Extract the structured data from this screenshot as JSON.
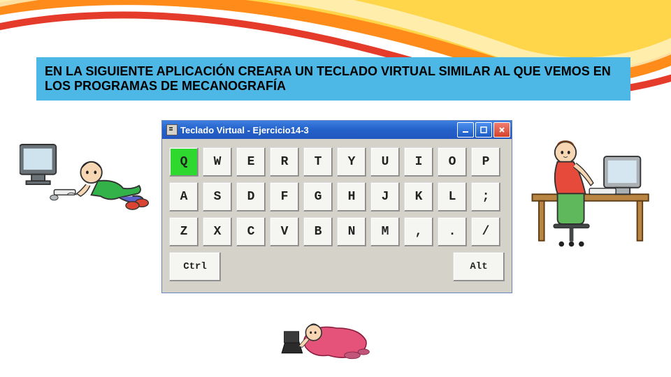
{
  "header": {
    "text": "EN LA SIGUIENTE APLICACIÓN CREARA  UN TECLADO VIRTUAL SIMILAR AL QUE VEMOS EN LOS PROGRAMAS DE MECANOGRAFÍA"
  },
  "window": {
    "title": "Teclado Virtual - Ejercicio14-3",
    "rows": [
      [
        "Q",
        "W",
        "E",
        "R",
        "T",
        "Y",
        "U",
        "I",
        "O",
        "P"
      ],
      [
        "A",
        "S",
        "D",
        "F",
        "G",
        "H",
        "J",
        "K",
        "L",
        ";"
      ],
      [
        "Z",
        "X",
        "C",
        "V",
        "B",
        "N",
        "M",
        ",",
        ".",
        "/"
      ]
    ],
    "bottom": {
      "left": "Ctrl",
      "right": "Alt"
    },
    "active_key": "Q"
  },
  "clipart": {
    "left_alt": "child-at-computer",
    "right_alt": "person-at-desk",
    "bottom_alt": "girl-with-laptop"
  }
}
